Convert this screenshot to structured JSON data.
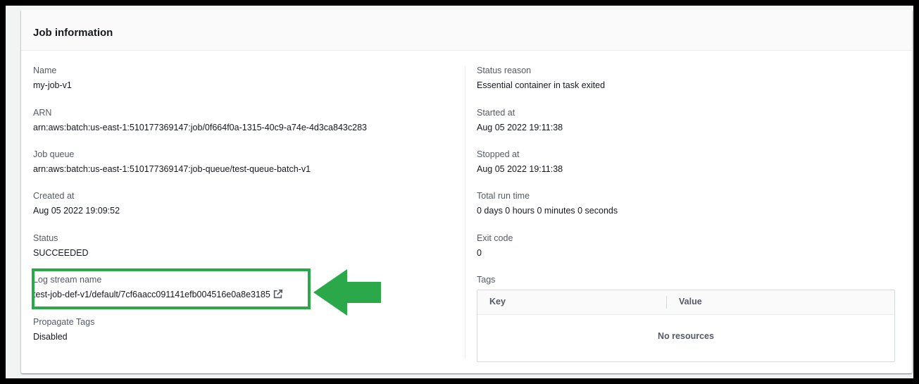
{
  "card": {
    "title": "Job information"
  },
  "left": {
    "name": {
      "label": "Name",
      "value": "my-job-v1"
    },
    "arn": {
      "label": "ARN",
      "value": "arn:aws:batch:us-east-1:510177369147:job/0f664f0a-1315-40c9-a74e-4d3ca843c283"
    },
    "job_queue": {
      "label": "Job queue",
      "value": "arn:aws:batch:us-east-1:510177369147:job-queue/test-queue-batch-v1"
    },
    "created_at": {
      "label": "Created at",
      "value": "Aug 05 2022 19:09:52"
    },
    "status": {
      "label": "Status",
      "value": "SUCCEEDED"
    },
    "log_stream": {
      "label": "Log stream name",
      "value": "test-job-def-v1/default/7cf6aacc091141efb004516e0a8e3185",
      "icon": "external-link-icon"
    },
    "propagate_tags": {
      "label": "Propagate Tags",
      "value": "Disabled"
    }
  },
  "right": {
    "status_reason": {
      "label": "Status reason",
      "value": "Essential container in task exited"
    },
    "started_at": {
      "label": "Started at",
      "value": "Aug 05 2022 19:11:38"
    },
    "stopped_at": {
      "label": "Stopped at",
      "value": "Aug 05 2022 19:11:38"
    },
    "total_run_time": {
      "label": "Total run time",
      "value": "0 days 0 hours 0 minutes 0 seconds"
    },
    "exit_code": {
      "label": "Exit code",
      "value": "0"
    },
    "tags": {
      "label": "Tags",
      "columns": [
        "Key",
        "Value"
      ],
      "empty_text": "No resources"
    }
  },
  "annotation": {
    "color": "#2aa84a"
  }
}
